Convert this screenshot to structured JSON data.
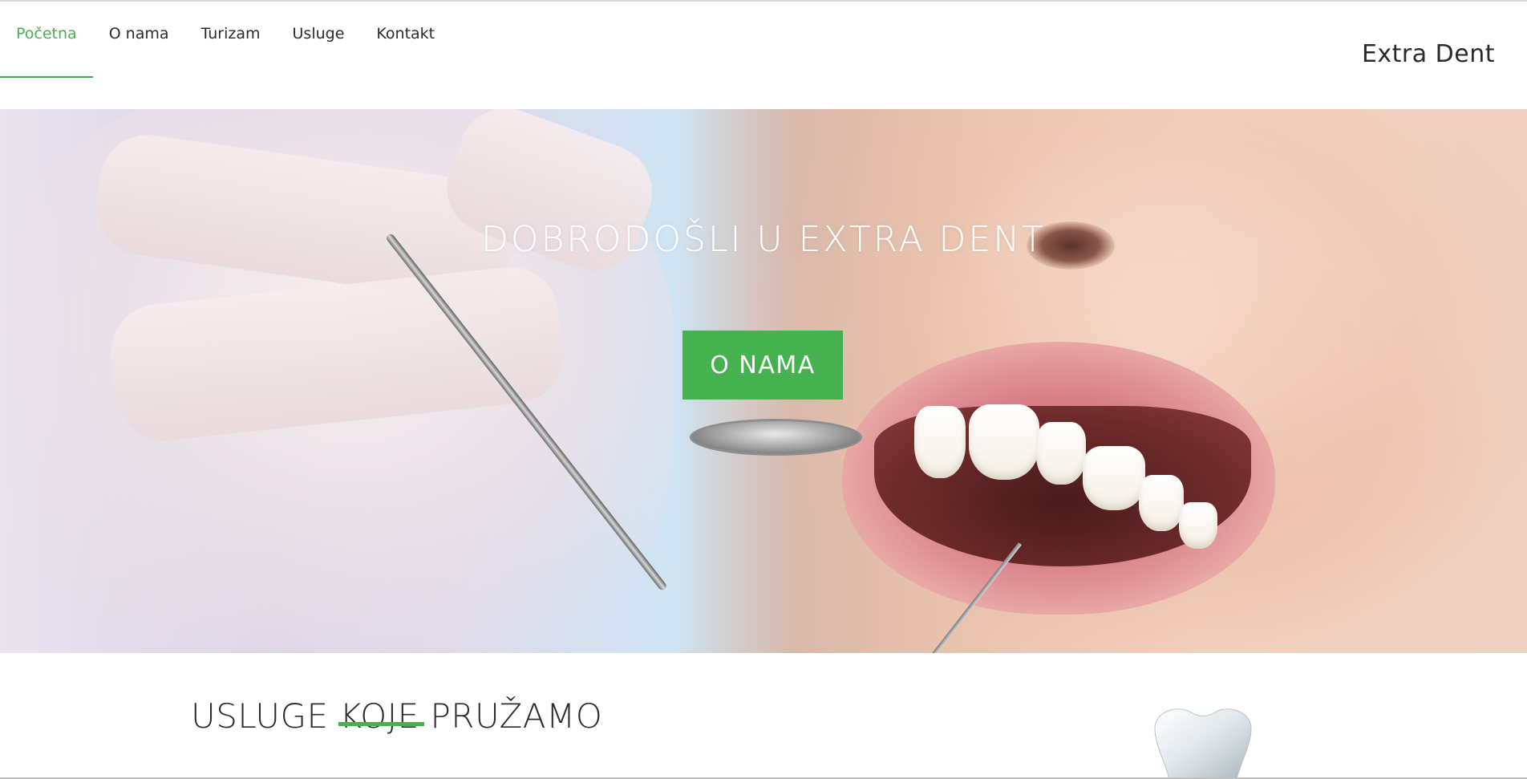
{
  "nav": {
    "items": [
      {
        "label": "Početna",
        "active": true
      },
      {
        "label": "O nama",
        "active": false
      },
      {
        "label": "Turizam",
        "active": false
      },
      {
        "label": "Usluge",
        "active": false
      },
      {
        "label": "Kontakt",
        "active": false
      }
    ]
  },
  "brand": {
    "name": "Extra Dent"
  },
  "hero": {
    "title": "DOBRODOŠLI U EXTRA DENT",
    "button_label": "O NAMA",
    "image": "dental-checkup-photo"
  },
  "services": {
    "title": "USLUGE KOJE PRUŽAMO",
    "icon": "tooth-icon"
  },
  "colors": {
    "accent": "#4cae52",
    "button": "#45b14f",
    "text": "#2b2b2b"
  }
}
